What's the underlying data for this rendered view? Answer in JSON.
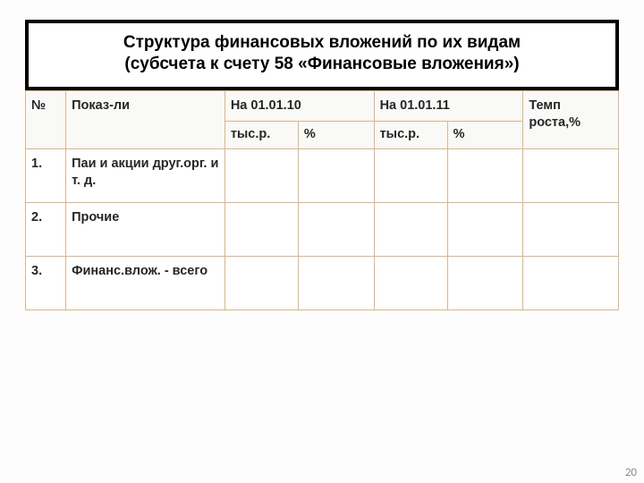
{
  "title": {
    "line1": "Структура финансовых вложений по их видам",
    "line2": "(субсчета к счету 58 «Финансовые вложения»)"
  },
  "header": {
    "num": "№",
    "indicator": "Показ-ли",
    "period1": "На 01.01.10",
    "period2": "На 01.01.11",
    "growth": "Темп роста,%",
    "thous": "тыс.р.",
    "percent": "%"
  },
  "rows": [
    {
      "n": "1.",
      "label": "Паи и акции друг.орг. и т. д.",
      "p1t": "",
      "p1p": "",
      "p2t": "",
      "p2p": "",
      "g": ""
    },
    {
      "n": "2.",
      "label": "Прочие",
      "p1t": "",
      "p1p": "",
      "p2t": "",
      "p2p": "",
      "g": ""
    },
    {
      "n": "3.",
      "label": "Финанс.влож. - всего",
      "p1t": "",
      "p1p": "",
      "p2t": "",
      "p2p": "",
      "g": ""
    }
  ],
  "page_number": "20"
}
